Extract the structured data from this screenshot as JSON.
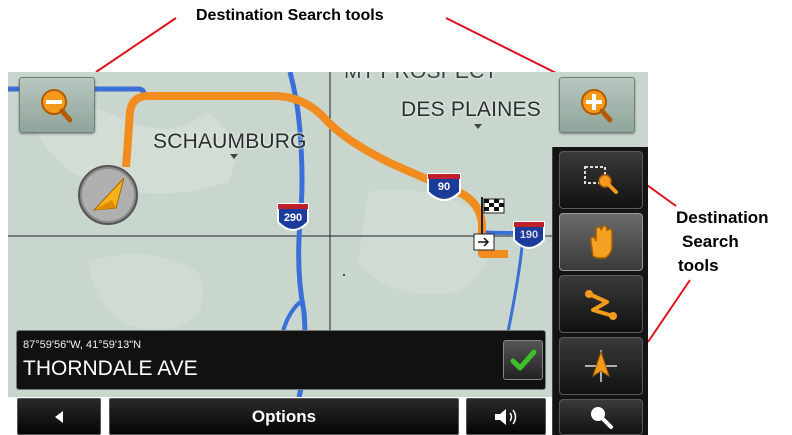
{
  "callouts": {
    "top": "Destination Search tools",
    "right_line1": "Destination",
    "right_line2": "Search",
    "right_line3": "tools"
  },
  "map": {
    "city_labels": [
      "SCHAUMBURG",
      "DES PLAINES",
      "MT PROSPECT"
    ],
    "highways": [
      "290",
      "90",
      "190"
    ],
    "route_color": "#f28c1e",
    "road_color": "#3b6fd8",
    "background_color": "#c9d6cd"
  },
  "info_bar": {
    "coordinates": "87°59'56\"W, 41°59'13\"N",
    "street": "THORNDALE AVE"
  },
  "bottom_bar": {
    "options_label": "Options"
  },
  "icons": {
    "zoom_out": "magnifier-minus-icon",
    "zoom_in": "magnifier-plus-icon",
    "vehicle": "vehicle-arrow-icon",
    "destination": "checkered-flag-icon",
    "search_area": "select-area-search-icon",
    "pan": "hand-pan-icon",
    "route": "route-icon",
    "position": "compass-arrow-icon",
    "search": "magnifier-icon",
    "back": "back-arrow-icon",
    "volume": "speaker-volume-icon",
    "confirm": "checkmark-icon"
  }
}
